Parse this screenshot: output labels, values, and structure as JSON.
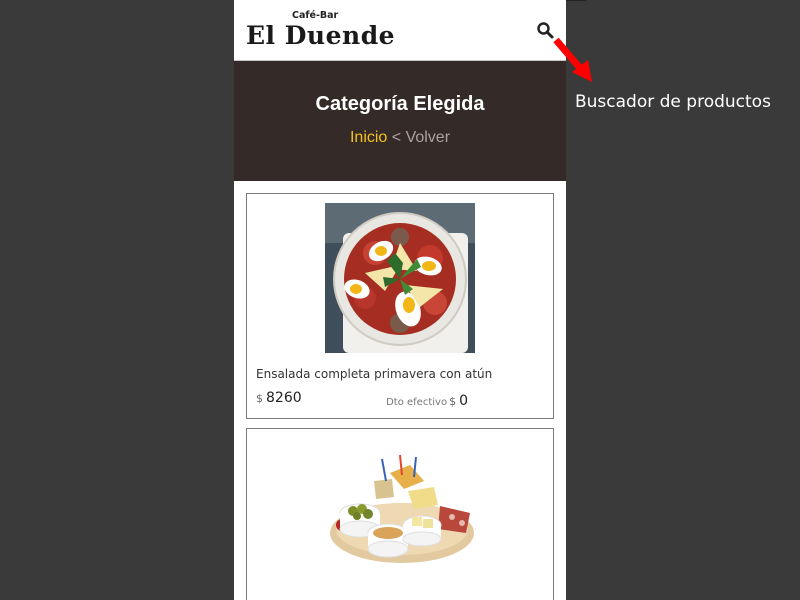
{
  "header": {
    "logo_small": "Café-Bar",
    "logo_big": "El Duende",
    "search_icon": "search-icon"
  },
  "banner": {
    "title": "Categoría Elegida",
    "breadcrumb_home": "Inicio",
    "breadcrumb_sep": " < ",
    "breadcrumb_back": "Volver"
  },
  "products": [
    {
      "name": "Ensalada completa primavera con atún",
      "currency": "$",
      "price": "8260",
      "discount_label": "Dto efectivo",
      "discount_currency": "$",
      "discount_value": "0"
    },
    {
      "name": "",
      "currency": "$",
      "price": "",
      "discount_label": "",
      "discount_currency": "",
      "discount_value": ""
    }
  ],
  "annotation": {
    "text": "Buscador de productos",
    "arrow_color": "#ff0000"
  },
  "colors": {
    "banner_bg": "#342a28",
    "accent": "#f4c21b",
    "page_bg": "#3a3a3a"
  }
}
